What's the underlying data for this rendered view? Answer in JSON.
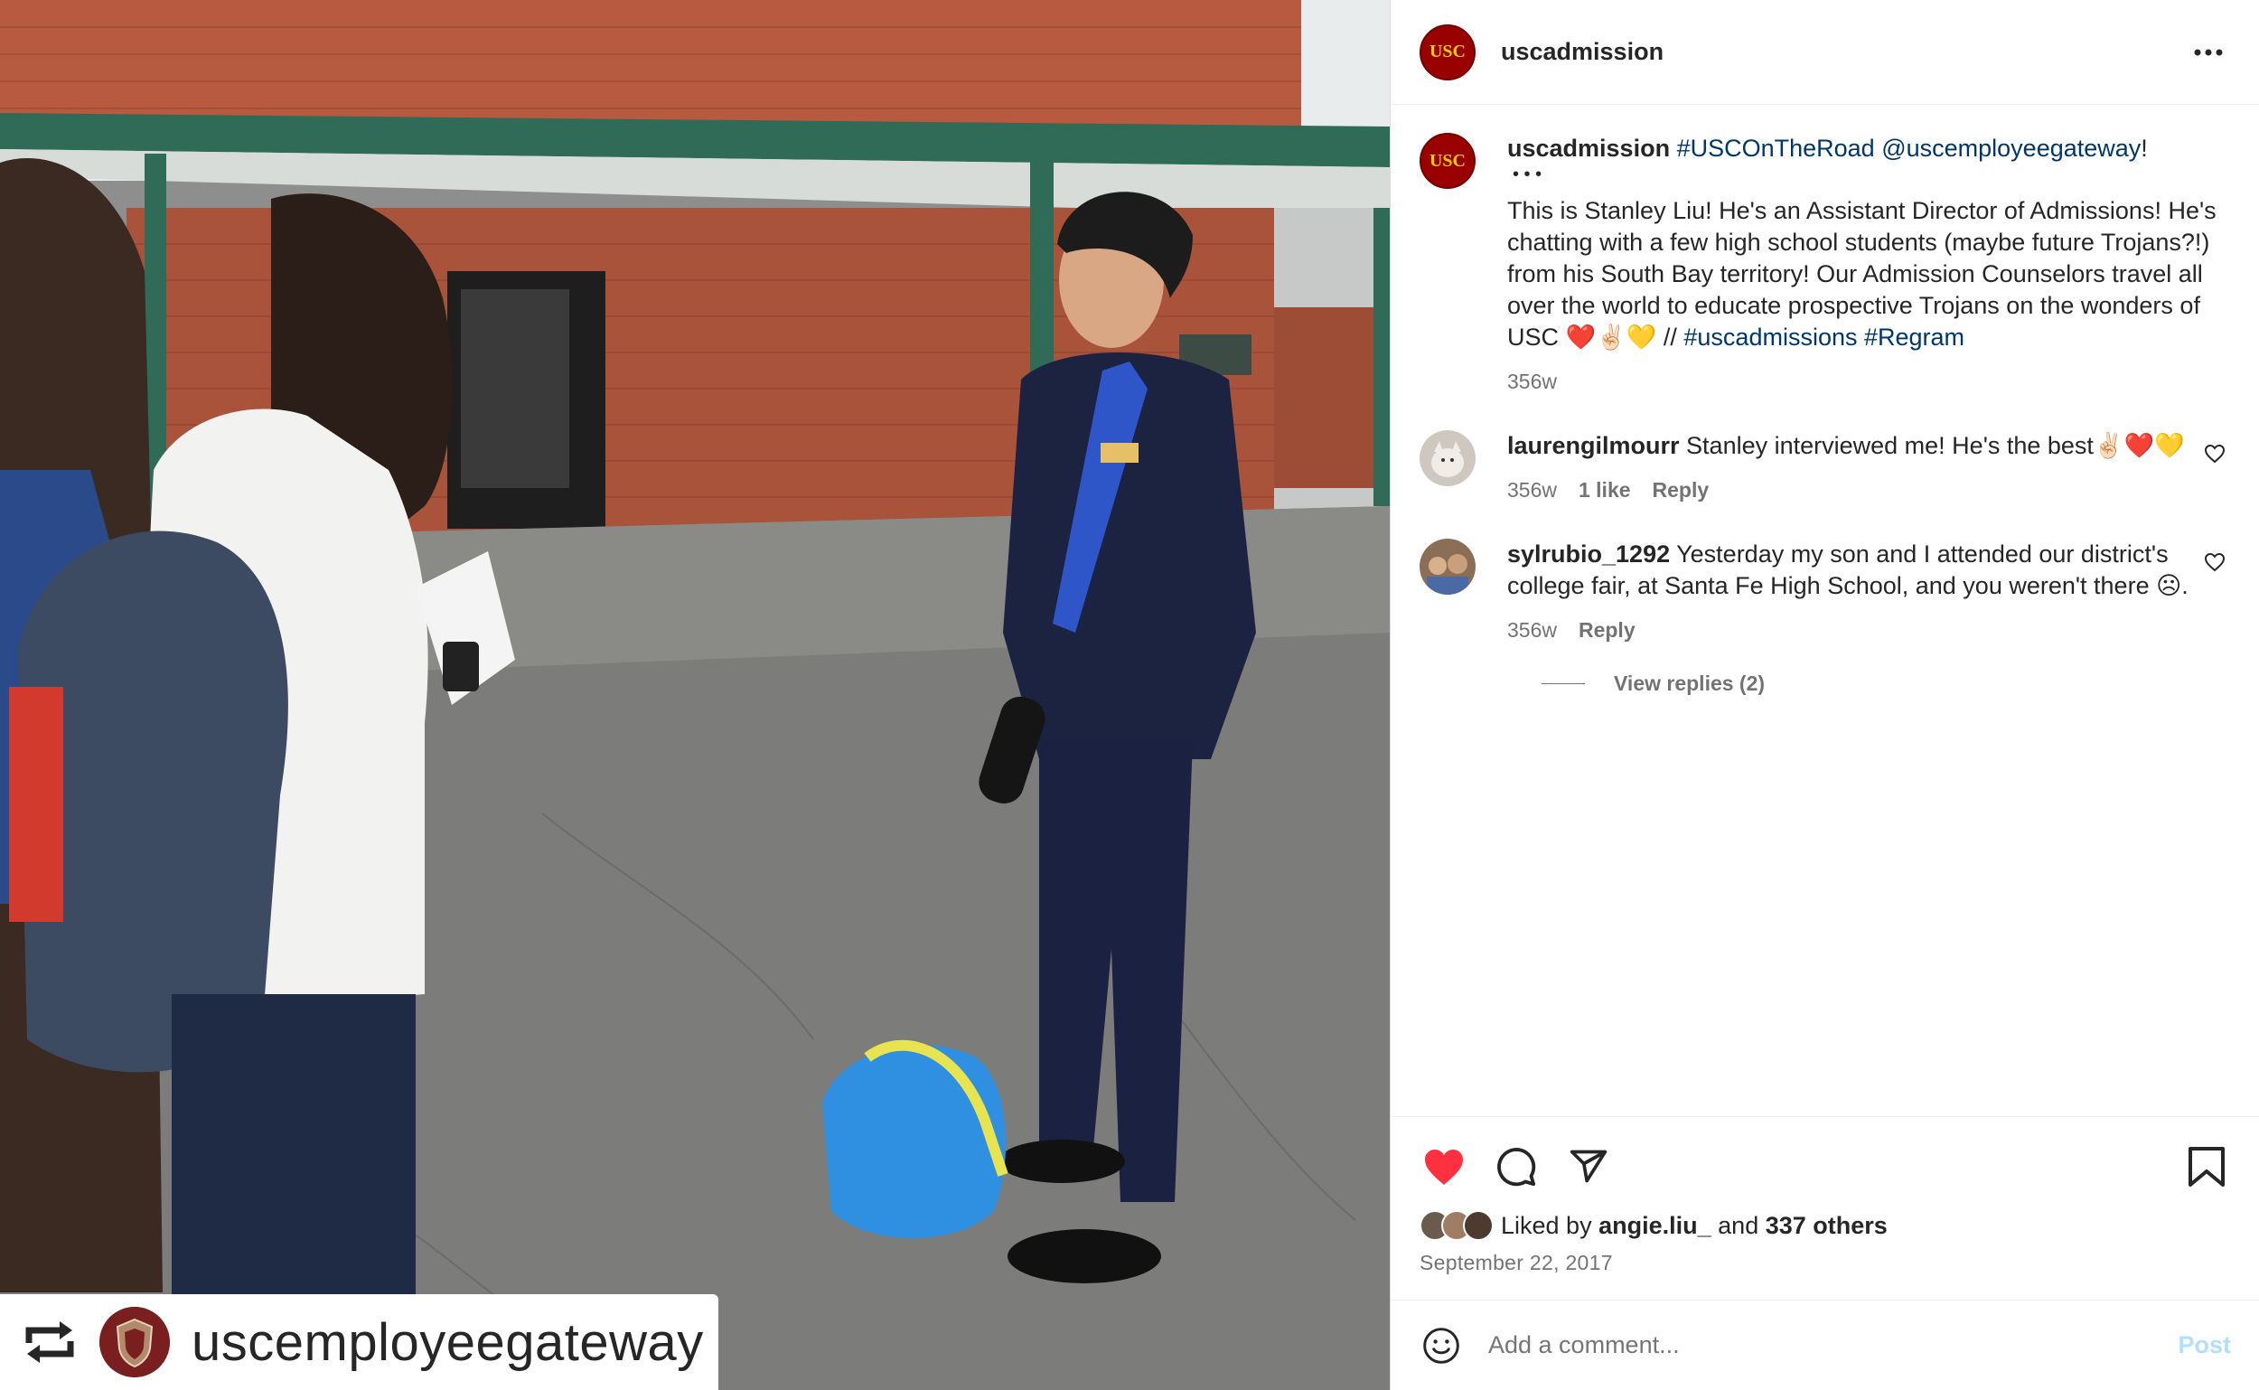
{
  "post": {
    "account": "uscadmission",
    "avatar_text": "USC",
    "more_icon": "more-horizontal-icon"
  },
  "caption": {
    "username": "uscadmission",
    "hashtag_1": "#USCOnTheRoad",
    "mention": "@uscemployeegateway",
    "excl": "!",
    "dots": "• • •",
    "text": "This is Stanley Liu! He's an Assistant Director of Admissions! He's chatting with a few high school students (maybe future Trojans?!) from his South Bay territory! Our Admission Counselors travel all over the world to educate prospective Trojans on the wonders of USC ❤️✌🏻💛 //",
    "hashtag_2": "#uscadmissions",
    "hashtag_3": "#Regram",
    "age": "356w"
  },
  "comments": [
    {
      "username": "laurengilmourr",
      "text": "Stanley interviewed me! He's the best✌🏻❤️💛",
      "age": "356w",
      "likes": "1 like",
      "reply": "Reply"
    },
    {
      "username": "sylrubio_1292",
      "text": "Yesterday my son and I attended our district's college fair, at Santa Fe High School, and you weren't there ☹.",
      "age": "356w",
      "reply": "Reply"
    }
  ],
  "view_replies": "View replies (2)",
  "engagement": {
    "liked_by_prefix": "Liked by",
    "liked_by_user": "angie.liu_",
    "and": "and",
    "others": "337 others",
    "date": "September 22, 2017",
    "liked": true,
    "like_color": "#ff3040"
  },
  "add_comment": {
    "placeholder": "Add a comment...",
    "post_label": "Post"
  },
  "regram": {
    "username": "uscemployeegateway",
    "icon": "repost-icon"
  },
  "colors": {
    "link": "#00376b",
    "muted": "#737373",
    "usc_cardinal": "#990000",
    "usc_gold": "#ffcc00",
    "post_disabled": "#b2dffc"
  }
}
